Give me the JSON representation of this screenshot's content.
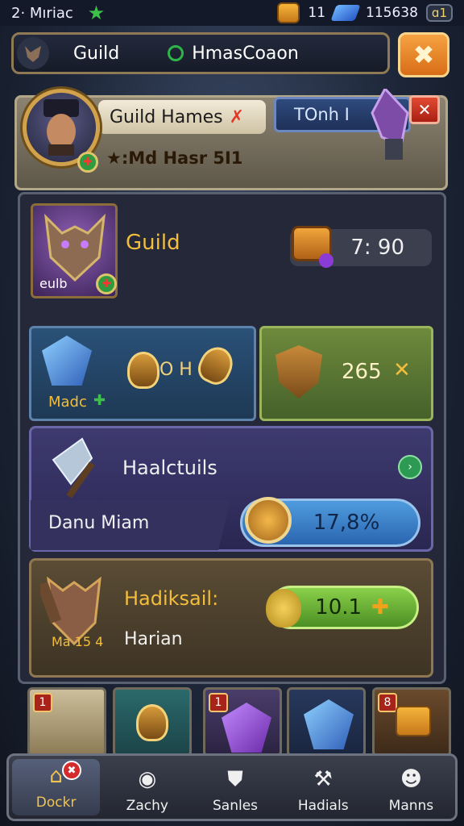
{
  "status": {
    "left_text": "2· Mıriac",
    "gold_count": "11",
    "gems_count": "115638",
    "box_value": "ɑ1"
  },
  "header": {
    "title": "Guild",
    "guild_name": "HmasCoaon",
    "close_icon": "star-close-icon"
  },
  "banner": {
    "tab1_label": "Guild Hames",
    "tab2_label": "TOnh I",
    "sub_label": "★:Md Hasr 5I1"
  },
  "guild_card": {
    "portrait_label": "eulb",
    "title": "Guild",
    "timer": "7: 90"
  },
  "row2": {
    "left_label": "Madc",
    "left_value": "O H",
    "right_value": "265"
  },
  "row3": {
    "title": "Haalctuils",
    "sub": "Danu Miam",
    "percent": "17,8%"
  },
  "row4": {
    "title": "Hadiksail:",
    "sub": "Harian",
    "portrait_label": "Ma 15 4",
    "value": "10.1"
  },
  "slots": [
    {
      "num": "1"
    },
    {
      "num": ""
    },
    {
      "num": "1"
    },
    {
      "num": ""
    },
    {
      "num": "8"
    }
  ],
  "nav": [
    {
      "label": "Dockr",
      "icon": "home-icon"
    },
    {
      "label": "Zachy",
      "icon": "ball-icon"
    },
    {
      "label": "Sanles",
      "icon": "shield-icon"
    },
    {
      "label": "Hadials",
      "icon": "axe-icon"
    },
    {
      "label": "Manns",
      "icon": "user-icon"
    }
  ]
}
